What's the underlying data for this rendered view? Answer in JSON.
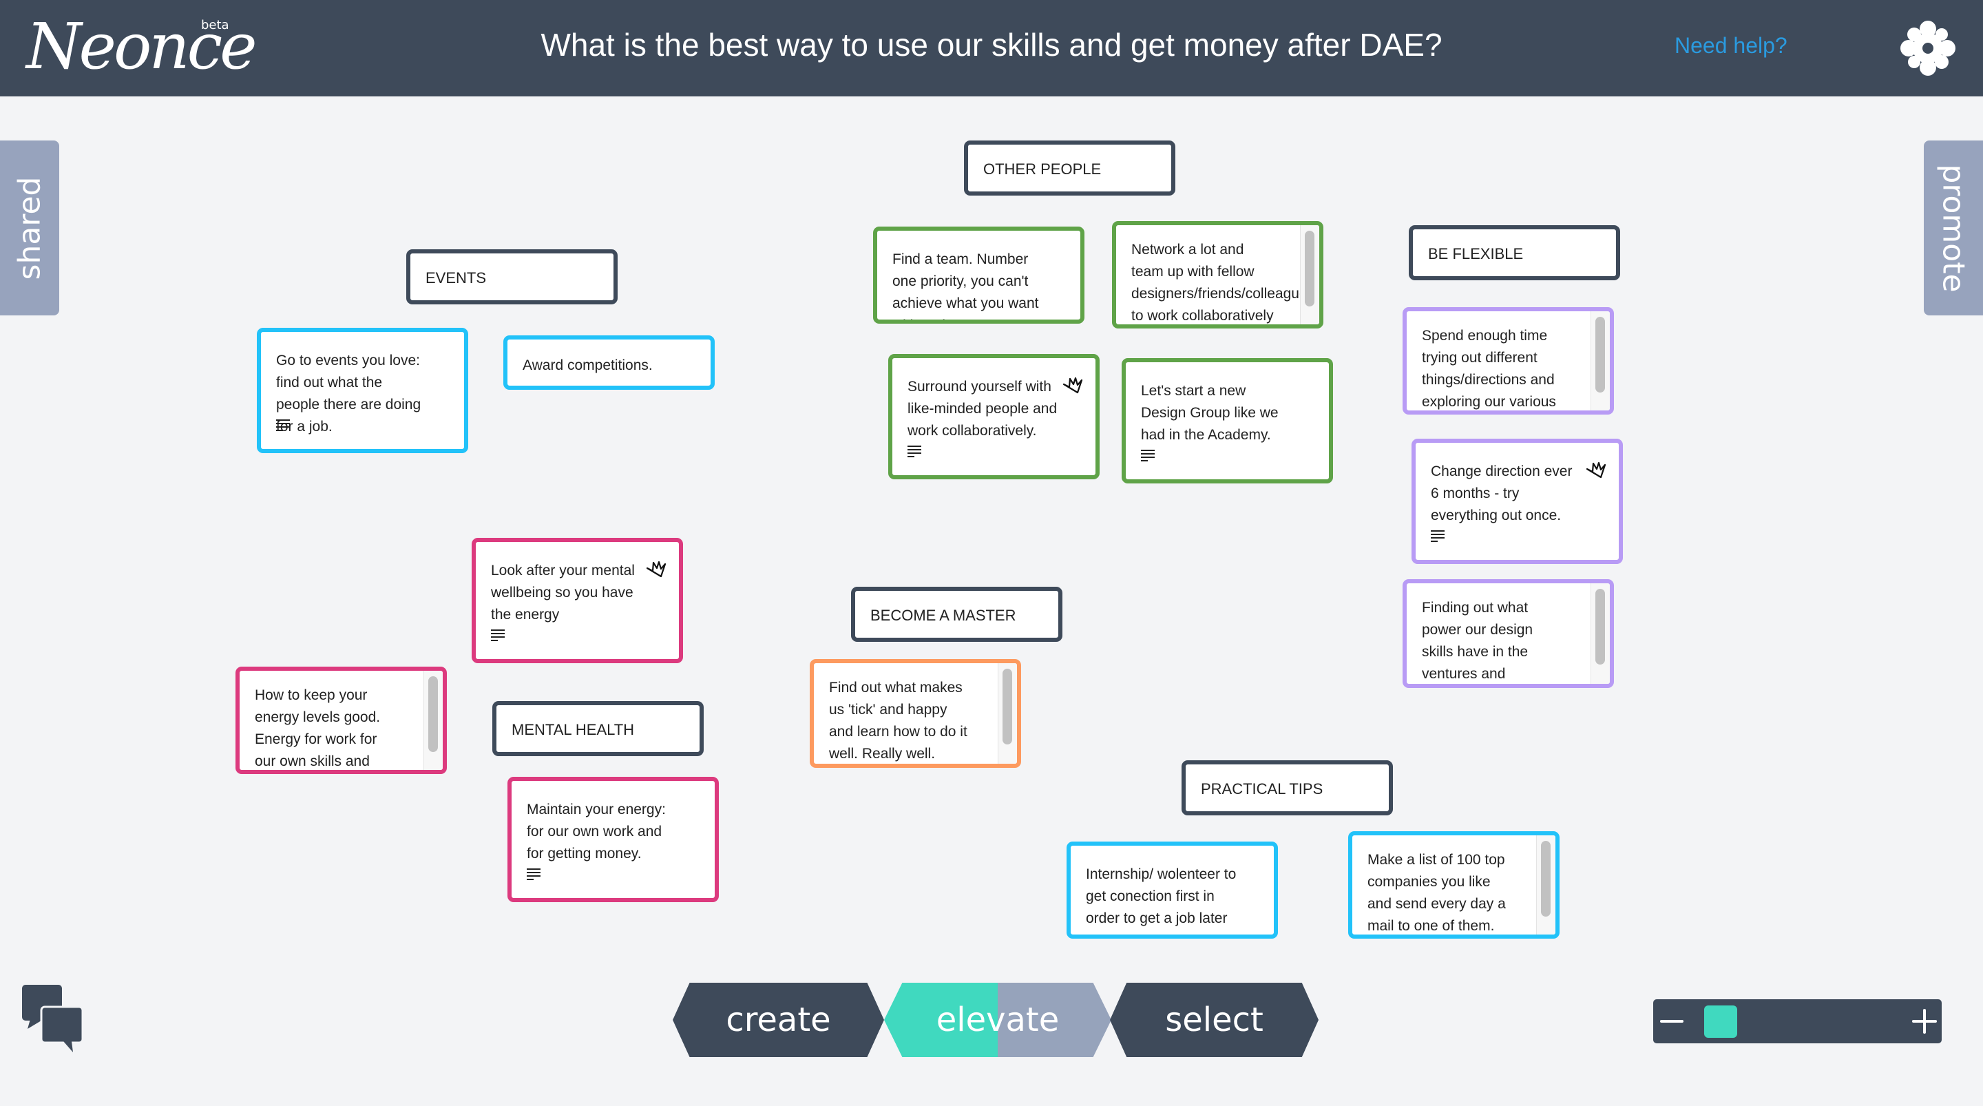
{
  "header": {
    "logo": "Neonce",
    "beta": "beta",
    "title": "What is the best way to use our skills and get money after DAE?",
    "help": "Need help?",
    "settings_icon": "puzzle-gear-icon"
  },
  "side_tabs": {
    "left": "shared",
    "right": "promote"
  },
  "colors": {
    "header": "#3e4a5a",
    "green": "#5fa348",
    "blue": "#22c2f9",
    "purple": "#b89bf5",
    "pink": "#dc3a7e",
    "orange": "#fd9a5f",
    "teal": "#40d9bf",
    "gray": "#96a3bb"
  },
  "groups": [
    {
      "id": "other",
      "label": "OTHER PEOPLE"
    },
    {
      "id": "events",
      "label": "EVENTS"
    },
    {
      "id": "flex",
      "label": "BE FLEXIBLE"
    },
    {
      "id": "master",
      "label": "BECOME A MASTER"
    },
    {
      "id": "mental",
      "label": "MENTAL HEALTH"
    },
    {
      "id": "tips",
      "label": "PRACTICAL TIPS"
    }
  ],
  "notes": [
    {
      "text": "Go to events you love: find out what the people there are doing for a job.",
      "color": "blue",
      "crown": false,
      "details": true,
      "scroll": false
    },
    {
      "text": "Award competitions.",
      "color": "blue",
      "crown": false,
      "details": false,
      "scroll": false
    },
    {
      "text": "Find a team. Number one priority, you can't achieve what you want without it",
      "color": "green",
      "crown": false,
      "details": false,
      "scroll": false
    },
    {
      "text": "Network a lot and team up with fellow designers/friends/colleagues to work collaboratively",
      "color": "green",
      "crown": false,
      "details": false,
      "scroll": true
    },
    {
      "text": "Surround yourself with like-minded people and work collaboratively.",
      "color": "green",
      "crown": true,
      "details": true,
      "scroll": false
    },
    {
      "text": "Let's start a new Design Group like we had in the Academy.",
      "color": "green",
      "crown": false,
      "details": true,
      "scroll": false
    },
    {
      "text": "Spend enough time trying out different things/directions and exploring our various",
      "color": "purple",
      "crown": false,
      "details": false,
      "scroll": true
    },
    {
      "text": "Change direction ever 6 months - try everything out once.",
      "color": "purple",
      "crown": true,
      "details": true,
      "scroll": false
    },
    {
      "text": "Finding out what power our design skills have in the ventures and companies in",
      "color": "purple",
      "crown": false,
      "details": false,
      "scroll": true
    },
    {
      "text": "Look after your mental wellbeing so you have the energy",
      "color": "pink",
      "crown": true,
      "details": true,
      "scroll": false
    },
    {
      "text": "How to keep your energy levels good. Energy for work for our own skills and",
      "color": "pink",
      "crown": false,
      "details": false,
      "scroll": true
    },
    {
      "text": "Maintain your energy: for our own work and for getting money.",
      "color": "pink",
      "crown": false,
      "details": true,
      "scroll": false
    },
    {
      "text": "Find out what makes us 'tick' and happy and learn how to do it well. Really well.",
      "color": "orange",
      "crown": false,
      "details": false,
      "scroll": true
    },
    {
      "text": "Internship/ wolenteer to get conection first in order to get a job later on",
      "color": "blue",
      "crown": false,
      "details": false,
      "scroll": false
    },
    {
      "text": "Make a list of 100 top companies you like and send every day a mail to one of them.",
      "color": "blue",
      "crown": false,
      "details": false,
      "scroll": true
    }
  ],
  "modes": {
    "create": "create",
    "elevate": "elevate",
    "select": "select",
    "active": "elevate",
    "elevate_progress_percent": 50
  },
  "zoom": {
    "level_percent": 5,
    "minus": "zoom-out",
    "plus": "zoom-in"
  }
}
